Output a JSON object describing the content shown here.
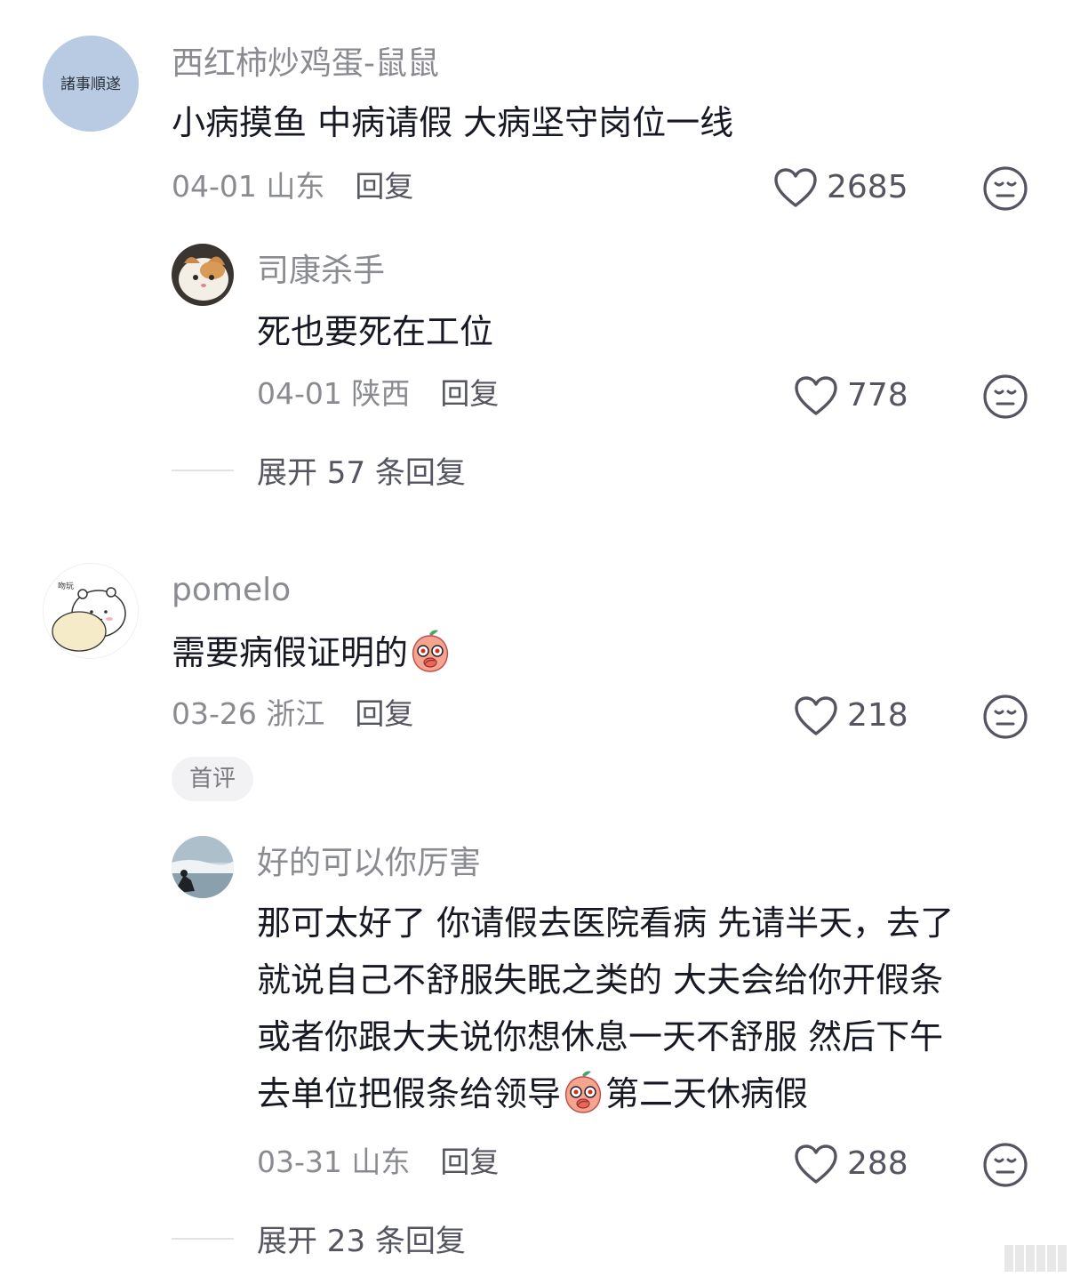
{
  "comments": [
    {
      "username": "西红柿炒鸡蛋-鼠鼠",
      "text": "小病摸鱼 中病请假 大病坚守岗位一线",
      "date_location": "04-01 山东",
      "reply_label": "回复",
      "likes": "2685",
      "avatar_text": "諸事順遂",
      "replies": [
        {
          "username": "司康杀手",
          "text": "死也要死在工位",
          "date_location": "04-01 陕西",
          "reply_label": "回复",
          "likes": "778"
        }
      ],
      "expand_label": "展开 57 条回复"
    },
    {
      "username": "pomelo",
      "text_before_emoji": "需要病假证明的",
      "date_location": "03-26 浙江",
      "reply_label": "回复",
      "likes": "218",
      "badge": "首评",
      "avatar_text": "吻玩",
      "replies": [
        {
          "username": "好的可以你厉害",
          "lines": [
            "那可太好了 你请假去医院看病 先请半天，去了",
            "就说自己不舒服失眠之类的 大夫会给你开假条",
            "或者你跟大夫说你想休息一天不舒服 然后下午"
          ],
          "last_line_before_emoji": "去单位把假条给领导",
          "last_line_after_emoji": "第二天休病假",
          "date_location": "03-31 山东",
          "reply_label": "回复",
          "likes": "288"
        }
      ],
      "expand_label": "展开 23 条回复"
    }
  ],
  "colors": {
    "username": "#8a8b91",
    "text": "#161823",
    "secondary": "#545560",
    "badge_bg": "#f2f2f4"
  },
  "icons": {
    "like": "heart-outline-icon",
    "dislike": "expressionless-face-icon",
    "inline_emoji": "peach-blush-emoji"
  }
}
